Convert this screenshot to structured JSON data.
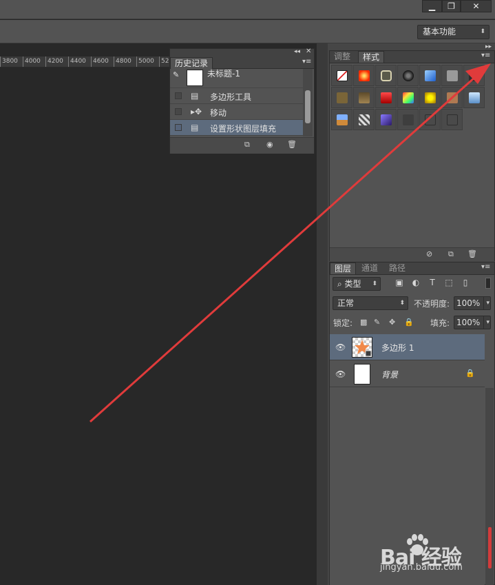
{
  "window": {
    "minimize_label": "▁",
    "restore_label": "❐",
    "close_label": "✕"
  },
  "options_bar": {
    "workspace": "基本功能"
  },
  "ruler": {
    "ticks": [
      "3800",
      "4000",
      "4200",
      "4400",
      "4600",
      "4800",
      "5000",
      "52"
    ]
  },
  "history_panel": {
    "title": "历史记录",
    "snapshot_label": "未标题-1",
    "items": [
      {
        "label": "多边形工具"
      },
      {
        "label": "移动"
      },
      {
        "label": "设置形状图层填充"
      }
    ]
  },
  "styles_panel": {
    "tabs": [
      "调整",
      "样式"
    ],
    "active_tab": "样式"
  },
  "layers_panel": {
    "tabs": [
      "图层",
      "通道",
      "路径"
    ],
    "active_tab": "图层",
    "filter_label": "类型",
    "blend_mode": "正常",
    "opacity_label": "不透明度:",
    "opacity_value": "100%",
    "lock_label": "锁定:",
    "fill_label": "填充:",
    "fill_value": "100%",
    "layers": [
      {
        "name": "多边形 1",
        "selected": true
      },
      {
        "name": "背景",
        "selected": false
      }
    ]
  },
  "watermark": {
    "brand": "Bai 经验",
    "url": "jingyan.baidu.com"
  },
  "colors": {
    "accent_arrow": "#e03b3b",
    "selection": "#5d6b7d"
  }
}
